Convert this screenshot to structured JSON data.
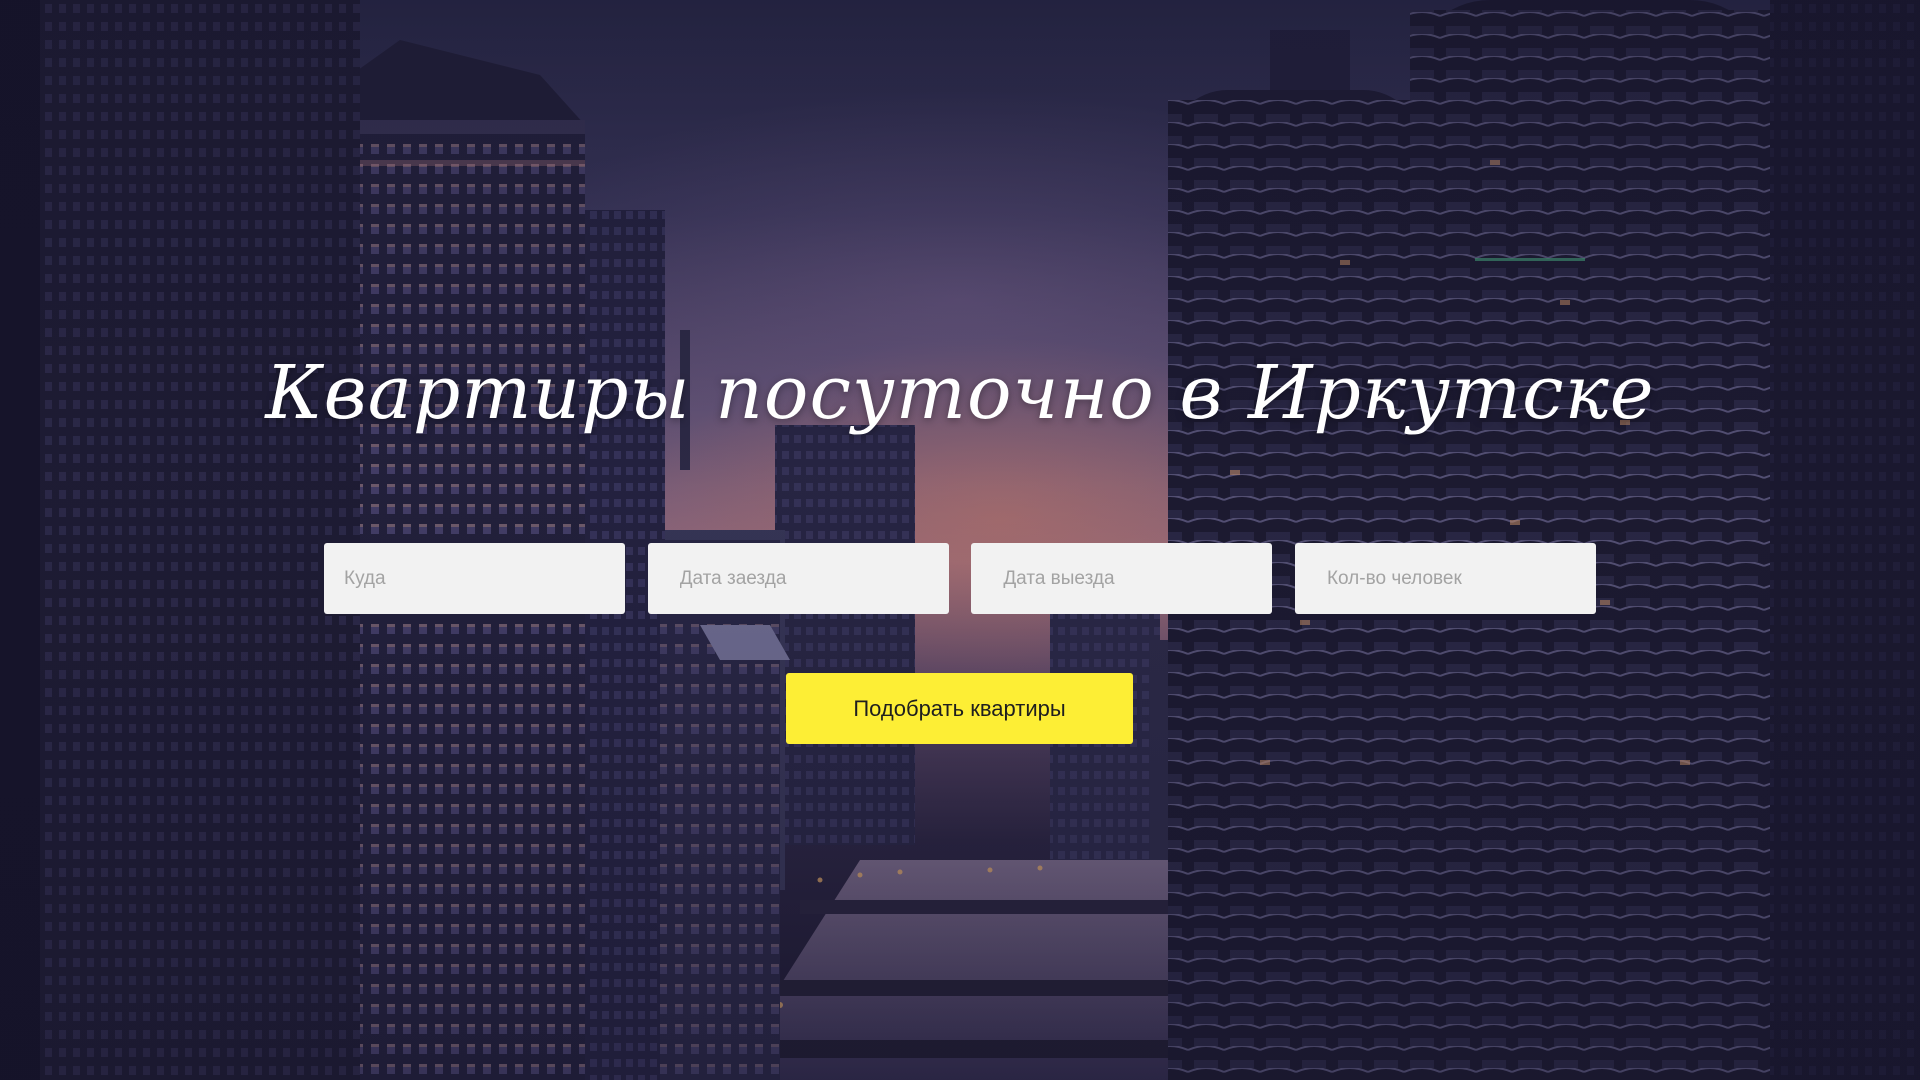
{
  "hero": {
    "title": "Квартиры посуточно в Иркутске"
  },
  "search": {
    "destination_placeholder": "Куда",
    "checkin_placeholder": "Дата заезда",
    "checkout_placeholder": "Дата выезда",
    "guests_placeholder": "Кол-во человек",
    "submit_label": "Подобрать квартиры"
  },
  "colors": {
    "button_bg": "#fdee35",
    "field_bg": "#f2f2f2",
    "title_color": "#ffffff"
  }
}
